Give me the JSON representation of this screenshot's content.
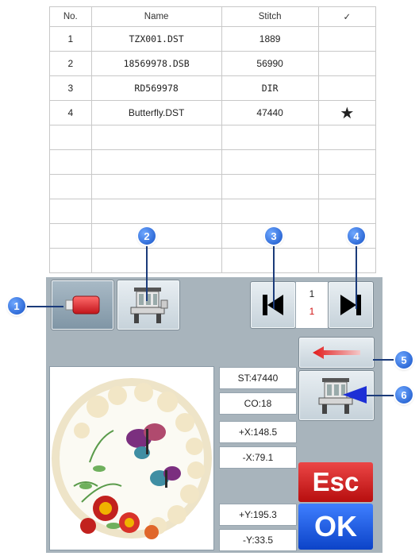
{
  "table": {
    "headers": [
      "No.",
      "Name",
      "Stitch",
      "✓"
    ],
    "rows": [
      {
        "no": "1",
        "name": "TZX001.DST",
        "stitch": "1889",
        "mark": ""
      },
      {
        "no": "2",
        "name": "18569978.DSB",
        "stitch": "56990",
        "mark": ""
      },
      {
        "no": "3",
        "name": "RD569978",
        "stitch": "DIR",
        "mark": ""
      },
      {
        "no": "4",
        "name": "Butterfly.DST",
        "stitch": "47440",
        "mark": "★"
      }
    ],
    "empty_rows": 6
  },
  "pager": {
    "page": "1",
    "total": "1"
  },
  "callouts": [
    "1",
    "2",
    "3",
    "4",
    "5",
    "6"
  ],
  "readouts": {
    "st": "ST:47440",
    "co": "CO:18",
    "plus_x": "+X:148.5",
    "minus_x": "-X:79.1",
    "plus_y": "+Y:195.3",
    "minus_y": "-Y:33.5"
  },
  "buttons": {
    "esc": "Esc",
    "ok": "OK"
  },
  "colors": {
    "panel": "#a8b4bc",
    "esc": "#d62020",
    "ok": "#1f5fe8",
    "callout": "#2a6ae6"
  },
  "icons": {
    "usb": "usb-drive-icon",
    "machine": "embroidery-machine-icon",
    "first_page": "skip-to-first-icon",
    "last_page": "skip-to-last-icon",
    "back": "back-arrow-icon"
  }
}
